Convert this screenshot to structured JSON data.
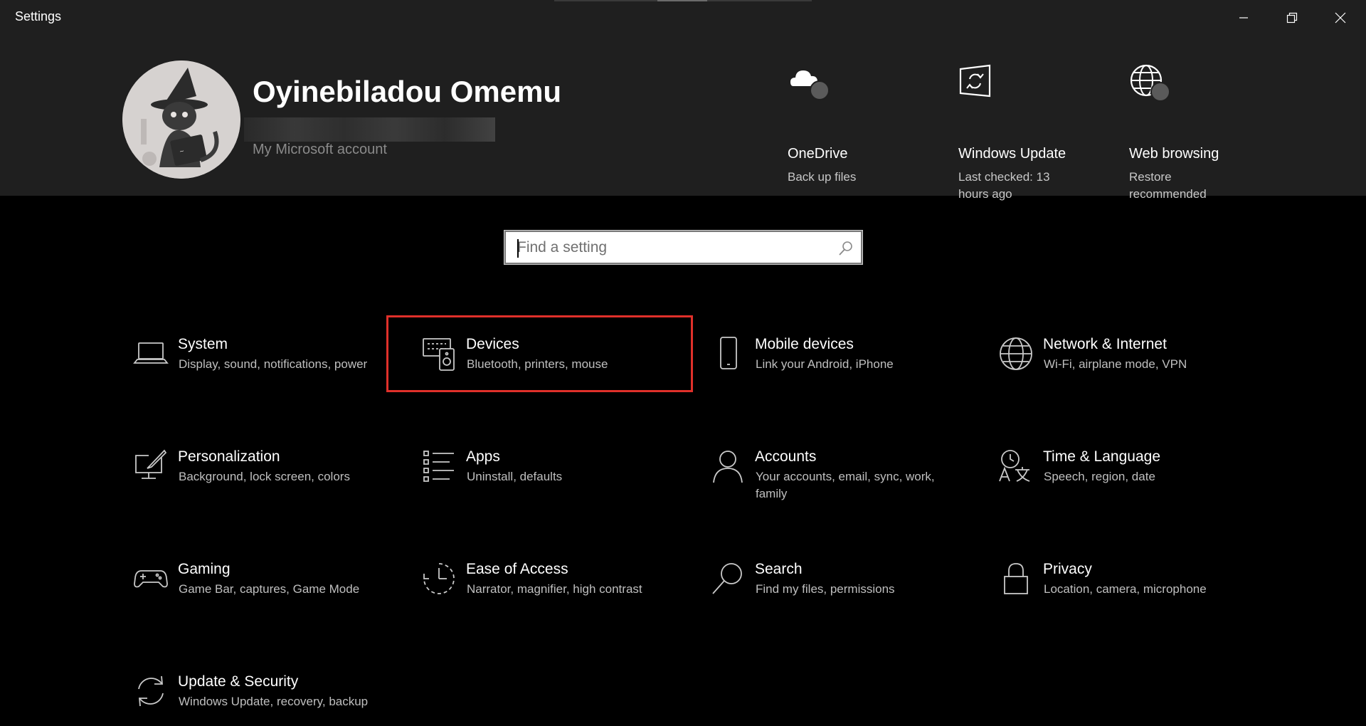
{
  "window": {
    "title": "Settings",
    "minimize_icon": "minimize-icon",
    "restore_icon": "restore-icon",
    "close_icon": "close-icon"
  },
  "profile": {
    "name": "Oyinebiladou Omemu",
    "account_link": "My Microsoft account"
  },
  "quick_actions": [
    {
      "title": "OneDrive",
      "subtitle": "Back up files",
      "icon": "onedrive-cloud-icon"
    },
    {
      "title": "Windows Update",
      "subtitle": "Last checked: 13 hours ago",
      "icon": "windows-update-icon"
    },
    {
      "title": "Web browsing",
      "subtitle": "Restore recommended",
      "icon": "web-browsing-globe-icon"
    }
  ],
  "search": {
    "placeholder": "Find a setting",
    "icon": "search-icon"
  },
  "categories": [
    {
      "title": "System",
      "desc": "Display, sound, notifications, power",
      "icon": "laptop-icon"
    },
    {
      "title": "Devices",
      "desc": "Bluetooth, printers, mouse",
      "icon": "devices-keyboard-speaker-icon"
    },
    {
      "title": "Mobile devices",
      "desc": "Link your Android, iPhone",
      "icon": "phone-icon"
    },
    {
      "title": "Network & Internet",
      "desc": "Wi-Fi, airplane mode, VPN",
      "icon": "globe-icon"
    },
    {
      "title": "Personalization",
      "desc": "Background, lock screen, colors",
      "icon": "paint-brush-icon"
    },
    {
      "title": "Apps",
      "desc": "Uninstall, defaults",
      "icon": "apps-list-icon"
    },
    {
      "title": "Accounts",
      "desc": "Your accounts, email, sync, work, family",
      "icon": "person-icon"
    },
    {
      "title": "Time & Language",
      "desc": "Speech, region, date",
      "icon": "time-language-icon"
    },
    {
      "title": "Gaming",
      "desc": "Game Bar, captures, Game Mode",
      "icon": "gamepad-icon"
    },
    {
      "title": "Ease of Access",
      "desc": "Narrator, magnifier, high contrast",
      "icon": "ease-of-access-icon"
    },
    {
      "title": "Search",
      "desc": "Find my files, permissions",
      "icon": "magnifier-icon"
    },
    {
      "title": "Privacy",
      "desc": "Location, camera, microphone",
      "icon": "lock-icon"
    },
    {
      "title": "Update & Security",
      "desc": "Windows Update, recovery, backup",
      "icon": "sync-arrows-icon"
    }
  ],
  "colors": {
    "highlight": "#e0302a",
    "background": "#000000",
    "header": "#1f1f1f"
  }
}
